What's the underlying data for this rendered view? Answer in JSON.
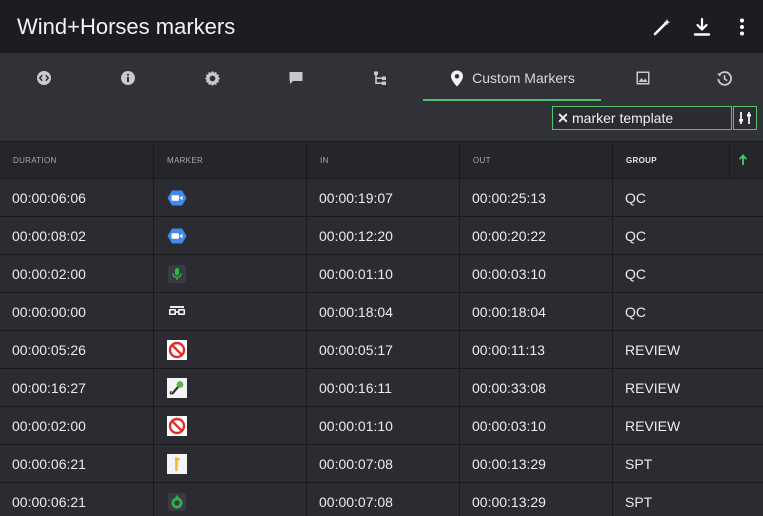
{
  "app": {
    "title": "Wind+Horses markers"
  },
  "toolbar": {
    "actions": [
      "magic-wand-icon",
      "download-icon",
      "more-vertical-icon"
    ]
  },
  "tabs": [
    {
      "icon": "code-icon",
      "label": ""
    },
    {
      "icon": "info-icon",
      "label": ""
    },
    {
      "icon": "settings-icon",
      "label": ""
    },
    {
      "icon": "comment-icon",
      "label": ""
    },
    {
      "icon": "hierarchy-icon",
      "label": ""
    },
    {
      "icon": "location-pin-icon",
      "label": "Custom Markers",
      "active": true
    },
    {
      "icon": "image-icon",
      "label": ""
    },
    {
      "icon": "history-icon",
      "label": ""
    }
  ],
  "filter": {
    "value": "marker template",
    "clear_icon": "close-icon",
    "settings_icon": "filter-settings-icon"
  },
  "columns": [
    {
      "label": "DURATION"
    },
    {
      "label": "MARKER"
    },
    {
      "label": "IN"
    },
    {
      "label": "OUT"
    },
    {
      "label": "GROUP",
      "sorted": "ascending"
    }
  ],
  "rows": [
    {
      "duration": "00:00:06:06",
      "marker_icon": "video-camera-icon",
      "in": "00:00:19:07",
      "out": "00:00:25:13",
      "group": "QC"
    },
    {
      "duration": "00:00:08:02",
      "marker_icon": "video-camera-icon",
      "in": "00:00:12:20",
      "out": "00:00:20:22",
      "group": "QC"
    },
    {
      "duration": "00:00:02:00",
      "marker_icon": "microphone-icon",
      "in": "00:00:01:10",
      "out": "00:00:03:10",
      "group": "QC"
    },
    {
      "duration": "00:00:00:00",
      "marker_icon": "glasses-icon",
      "in": "00:00:18:04",
      "out": "00:00:18:04",
      "group": "QC"
    },
    {
      "duration": "00:00:05:26",
      "marker_icon": "prohibited-icon",
      "in": "00:00:05:17",
      "out": "00:00:11:13",
      "group": "REVIEW"
    },
    {
      "duration": "00:00:16:27",
      "marker_icon": "microphone-card-icon",
      "in": "00:00:16:11",
      "out": "00:00:33:08",
      "group": "REVIEW"
    },
    {
      "duration": "00:00:02:00",
      "marker_icon": "prohibited-icon",
      "in": "00:00:01:10",
      "out": "00:00:03:10",
      "group": "REVIEW"
    },
    {
      "duration": "00:00:06:21",
      "marker_icon": "hand-card-icon",
      "in": "00:00:07:08",
      "out": "00:00:13:29",
      "group": "SPT"
    },
    {
      "duration": "00:00:06:21",
      "marker_icon": "leaf-badge-icon",
      "in": "00:00:07:08",
      "out": "00:00:13:29",
      "group": "SPT"
    }
  ],
  "colors": {
    "accent": "#4cc36a",
    "titlebar": "#1c1d21",
    "background": "#2b2c31"
  }
}
